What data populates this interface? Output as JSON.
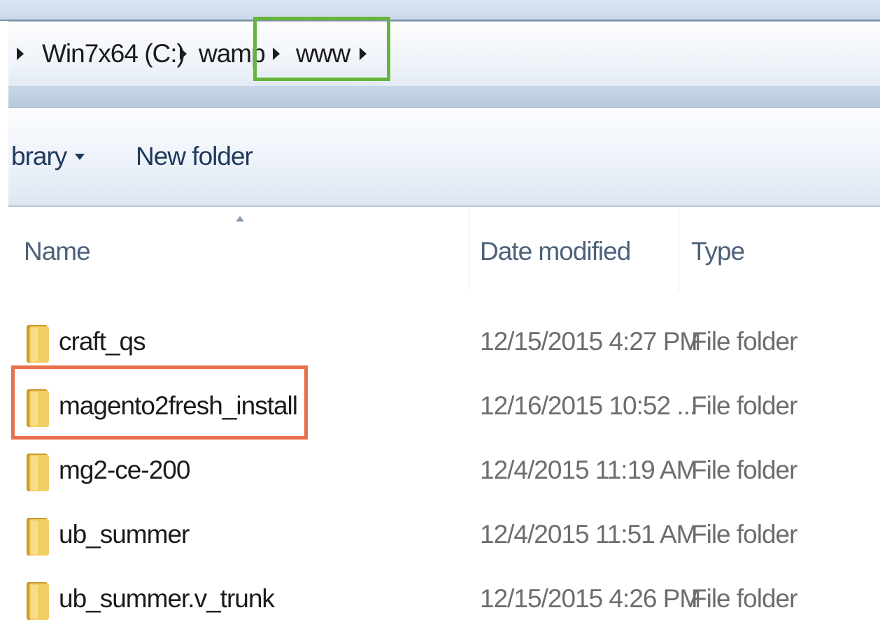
{
  "address_bar": {
    "crumbs": [
      "Win7x64 (C:)",
      "wamp",
      "www"
    ]
  },
  "toolbar": {
    "library_label": "brary",
    "new_folder_label": "New folder"
  },
  "columns": {
    "name": "Name",
    "date_modified": "Date modified",
    "type": "Type"
  },
  "files": [
    {
      "name": "craft_qs",
      "date": "12/15/2015 4:27 PM",
      "type": "File folder"
    },
    {
      "name": "magento2fresh_install",
      "date": "12/16/2015 10:52 ...",
      "type": "File folder"
    },
    {
      "name": "mg2-ce-200",
      "date": "12/4/2015 11:19 AM",
      "type": "File folder"
    },
    {
      "name": "ub_summer",
      "date": "12/4/2015 11:51 AM",
      "type": "File folder"
    },
    {
      "name": "ub_summer.v_trunk",
      "date": "12/15/2015 4:26 PM",
      "type": "File folder"
    }
  ],
  "icons": {
    "folder": "folder-icon",
    "breadcrumb_separator": "chevron-right-icon",
    "dropdown": "chevron-down-icon",
    "sort": "sort-ascending-icon"
  },
  "colors": {
    "highlight_path": "#66b53a",
    "highlight_item": "#e8704d",
    "folder": "#e9c25a"
  }
}
